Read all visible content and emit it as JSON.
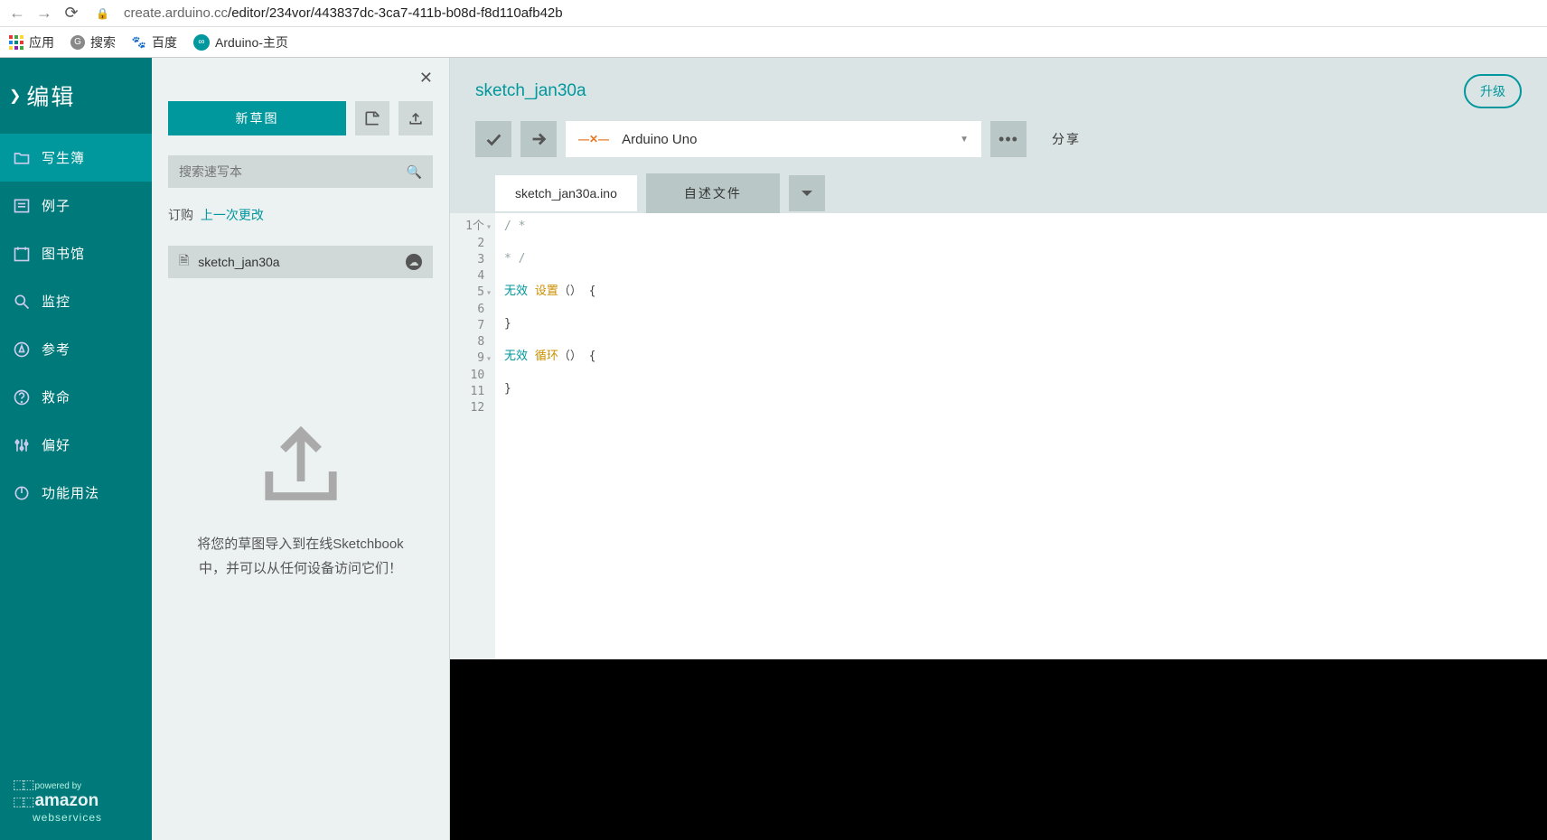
{
  "browser": {
    "url_host": "create.arduino.cc",
    "url_path": "/editor/234vor/443837dc-3ca7-411b-b08d-f8d110afb42b",
    "bookmarks": [
      {
        "name": "apps",
        "label": "应用"
      },
      {
        "name": "search",
        "label": "搜索"
      },
      {
        "name": "baidu",
        "label": "百度"
      },
      {
        "name": "arduino-home",
        "label": "Arduino-主页"
      }
    ]
  },
  "sidebar": {
    "edit_label": "编辑",
    "items": [
      {
        "name": "sketchbook",
        "label": "写生簿"
      },
      {
        "name": "examples",
        "label": "例子"
      },
      {
        "name": "libraries",
        "label": "图书馆"
      },
      {
        "name": "monitor",
        "label": "监控"
      },
      {
        "name": "reference",
        "label": "参考"
      },
      {
        "name": "help",
        "label": "救命"
      },
      {
        "name": "preferences",
        "label": "偏好"
      },
      {
        "name": "features",
        "label": "功能用法"
      }
    ],
    "aws": {
      "powered": "powered by",
      "amazon": "amazon",
      "ws": "webservices"
    }
  },
  "panel": {
    "new_sketch": "新草图",
    "search_placeholder": "搜索速写本",
    "order_label": "订购",
    "order_link": "上一次更改",
    "sketch_name": "sketch_jan30a",
    "upload_text": "将您的草图导入到在线Sketchbook中，并可以从任何设备访问它们！"
  },
  "editor": {
    "title": "sketch_jan30a",
    "upgrade": "升级",
    "board": "Arduino Uno",
    "share": "分享",
    "tab_primary": "sketch_jan30a.ino",
    "tab_secondary": "自述文件",
    "code_lines": [
      {
        "n": "1个",
        "fold": "▾",
        "cmt": "/ *"
      },
      {
        "n": "2",
        "fold": "",
        "cmt": ""
      },
      {
        "n": "3",
        "fold": "",
        "cmt": "* /"
      },
      {
        "n": "4",
        "fold": "",
        "cmt": ""
      },
      {
        "n": "5",
        "fold": "▾",
        "kw": "无效",
        "fn": "设置",
        "rest": "（） {"
      },
      {
        "n": "6",
        "fold": "",
        "cmt": ""
      },
      {
        "n": "7",
        "fold": "",
        "rest": "}"
      },
      {
        "n": "8",
        "fold": "",
        "cmt": ""
      },
      {
        "n": "9",
        "fold": "▾",
        "kw": "无效",
        "fn": "循环",
        "rest": "（） {"
      },
      {
        "n": "10",
        "fold": "",
        "cmt": ""
      },
      {
        "n": "11",
        "fold": "",
        "rest": "}"
      },
      {
        "n": "12",
        "fold": "",
        "cmt": ""
      }
    ]
  }
}
